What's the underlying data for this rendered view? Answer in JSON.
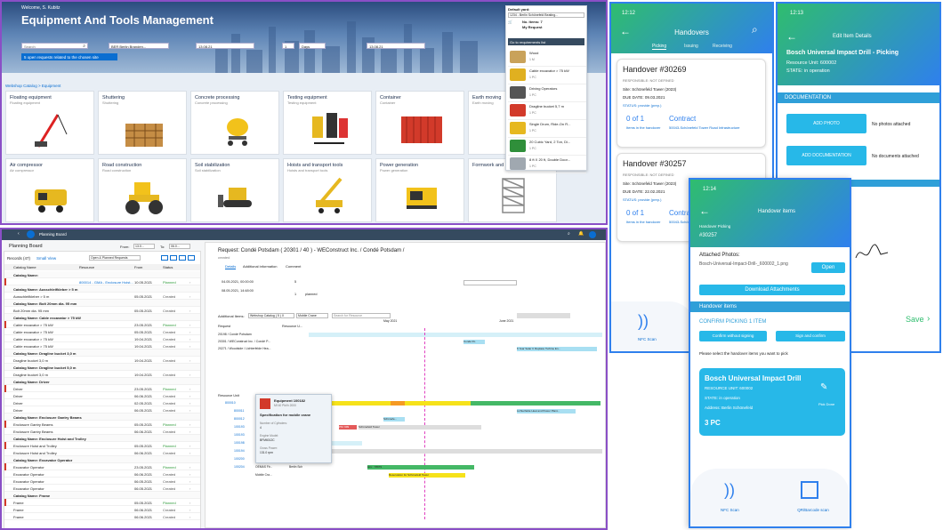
{
  "catalog": {
    "welcome": "Welcome, S. Kubitz",
    "title": "Equipment And Tools Management",
    "search_placeholder": "Search",
    "location": "BER Berlin Branden...",
    "date_from": "13.08.21",
    "days_value": "1",
    "days_unit": "Days",
    "date_to": "13.08.21",
    "requests_banner": "5 open requests related to the chosen site",
    "breadcrumb": "Webshop Catalog > Equipment",
    "default_yard_label": "Default yard:",
    "default_yard_value": "1234 - Berlin Schönefeld Beating...",
    "no_items": "No. Items: 7",
    "my_request": "My Request",
    "goto_list": "Go to requirements list",
    "tiles": [
      {
        "title": "Floating equipment",
        "sub": "Floating equipment"
      },
      {
        "title": "Shuttering",
        "sub": "Shuttering"
      },
      {
        "title": "Concrete processing",
        "sub": "Concrete processing"
      },
      {
        "title": "Testing equipment",
        "sub": "Testing equipment"
      },
      {
        "title": "Container",
        "sub": "Container"
      },
      {
        "title": "Earth moving",
        "sub": "Earth moving"
      },
      {
        "title": "Air compressor",
        "sub": "Air compressor"
      },
      {
        "title": "Road construction",
        "sub": "Road construction"
      },
      {
        "title": "Soil stabilization",
        "sub": "Soil stabilization"
      },
      {
        "title": "Hoists and transport tools",
        "sub": "Hoists and transport tools"
      },
      {
        "title": "Power generation",
        "sub": "Power generation"
      },
      {
        "title": "Formwork and",
        "sub": "Formwork and"
      }
    ],
    "request_items": [
      {
        "name": "Wood",
        "qty": "1 M",
        "color": "#c9a25a"
      },
      {
        "name": "Cable excavator > 75 kW",
        "qty": "1 PC",
        "color": "#e0b020"
      },
      {
        "name": "Driving Operators",
        "qty": "1 PC",
        "color": "#555555"
      },
      {
        "name": "Dragline bucket 5,7 m",
        "qty": "1 PC",
        "color": "#d23a2a"
      },
      {
        "name": "Single Drum, Ride-On R...",
        "qty": "1 PC",
        "color": "#e6b820"
      },
      {
        "name": "20 Cubic Yard, 2 Ton, Di...",
        "qty": "1 PC",
        "color": "#2f8f3a"
      },
      {
        "name": "8 ft X 20 ft, Double Door...",
        "qty": "1 PC",
        "color": "#a0a8b0"
      }
    ]
  },
  "planning": {
    "app_title": "Planning Board",
    "page_title": "Planning Board",
    "from_label": "From:",
    "from_value": "13.0...",
    "to_label": "To:",
    "to_value": "06.0...",
    "records": "Records (47)",
    "view": "Small View",
    "filter": "Open & Planned Requests",
    "columns": [
      "Catalog Name",
      "Resource",
      "From",
      "Status"
    ],
    "rows": [
      {
        "g": true,
        "name": "Catalog Name:"
      },
      {
        "name": "",
        "res": "800014 - GMA - Enclosure Hoist...",
        "from": "10.05.2021",
        "status": "Planned"
      },
      {
        "g": true,
        "name": "Catalog Name: Ausschleifkleber > 5 m"
      },
      {
        "name": "Ausschleifkleber > 5 m",
        "res": "",
        "from": "05.05.2021",
        "status": "Created"
      },
      {
        "g": true,
        "name": "Catalog Name: Bolt 20mm dia. 95 mm"
      },
      {
        "name": "Bolt 20mm dia. 95 mm",
        "res": "",
        "from": "05.05.2021",
        "status": "Created"
      },
      {
        "g": true,
        "name": "Catalog Name: Cable excavator > 75 kW"
      },
      {
        "name": "Cable excavator > 75 kW",
        "res": "",
        "from": "23.05.2021",
        "status": "Planned"
      },
      {
        "name": "Cable excavator > 75 kW",
        "res": "",
        "from": "05.05.2021",
        "status": "Created"
      },
      {
        "name": "Cable excavator > 75 kW",
        "res": "",
        "from": "19.04.2021",
        "status": "Created"
      },
      {
        "name": "Cable excavator > 75 kW",
        "res": "",
        "from": "19.04.2021",
        "status": "Created"
      },
      {
        "g": true,
        "name": "Catalog Name: Dragline bucket 3,0 m"
      },
      {
        "name": "Dragline bucket 3,0 m",
        "res": "",
        "from": "19.04.2021",
        "status": "Created"
      },
      {
        "g": true,
        "name": "Catalog Name: Dragline bucket 5,0 m"
      },
      {
        "name": "Dragline bucket 3,0 m",
        "res": "",
        "from": "19.04.2021",
        "status": "Created"
      },
      {
        "g": true,
        "name": "Catalog Name: Driver"
      },
      {
        "name": "Driver",
        "res": "",
        "from": "23.05.2021",
        "status": "Planned"
      },
      {
        "name": "Driver",
        "res": "",
        "from": "06.06.2021",
        "status": "Created"
      },
      {
        "name": "Driver",
        "res": "",
        "from": "02.05.2021",
        "status": "Created"
      },
      {
        "name": "Driver",
        "res": "",
        "from": "06.05.2021",
        "status": "Created"
      },
      {
        "g": true,
        "name": "Catalog Name: Enclosure Gantry Beams"
      },
      {
        "name": "Enclosure Gantry Beams",
        "res": "",
        "from": "05.05.2021",
        "status": "Planned"
      },
      {
        "name": "Enclosure Gantry Beams",
        "res": "",
        "from": "06.06.2021",
        "status": "Created"
      },
      {
        "g": true,
        "name": "Catalog Name: Enclosure Hoist and Trolley"
      },
      {
        "name": "Enclosure Hoist and Trolley",
        "res": "",
        "from": "05.05.2021",
        "status": "Planned"
      },
      {
        "name": "Enclosure Hoist and Trolley",
        "res": "",
        "from": "06.06.2021",
        "status": "Created"
      },
      {
        "g": true,
        "name": "Catalog Name: Excavator Operator"
      },
      {
        "name": "Excavator Operator",
        "res": "",
        "from": "23.05.2021",
        "status": "Planned"
      },
      {
        "name": "Excavator Operator",
        "res": "",
        "from": "06.06.2021",
        "status": "Created"
      },
      {
        "name": "Excavator Operator",
        "res": "",
        "from": "06.05.2021",
        "status": "Created"
      },
      {
        "name": "Excavator Operator",
        "res": "",
        "from": "06.05.2021",
        "status": "Created"
      },
      {
        "g": true,
        "name": "Catalog Name: Frame"
      },
      {
        "name": "Frame",
        "res": "",
        "from": "05.05.2021",
        "status": "Planned"
      },
      {
        "name": "Frame",
        "res": "",
        "from": "06.06.2021",
        "status": "Created"
      },
      {
        "name": "Frame",
        "res": "",
        "from": "06.06.2021",
        "status": "Created"
      }
    ],
    "request_title": "Request: Condé Potsdam ( 20301 / 40 ) - WEConstruct Inc. / Condé Potsdam /",
    "request_status": "created",
    "tabs": [
      "Details",
      "Additional information",
      "Comment"
    ],
    "from_dt": "04.05.2021, 00:00:00",
    "to_dt": "08.05.2021, 14:48:00",
    "in_use_for": "5",
    "requested_qty": "1",
    "planned": "planned",
    "additional_items": "Additional Items:",
    "filter_chips": [
      "Webshop Catalog ( 5 ) X",
      "Mobile Crane"
    ],
    "search_resource": "Search for Resource",
    "request_col": "Request",
    "resource_col": "Resource U...",
    "req_rows": [
      "20198 / Condé Potsdam",
      "20301 / WEConstruct Inc. / Condé P...",
      "20271 / Woodside / Lichterfelde Hea..."
    ],
    "bar_labels": [
      "Condé Po",
      "6 Year Solar C Replace Turbine En..."
    ],
    "months": [
      "May 2021",
      "June 2021"
    ],
    "resource_unit": "Resource Unit",
    "units": [
      "800010",
      "800011",
      "800012",
      "100193",
      "100193",
      "100198",
      "100194",
      "100200",
      "100204"
    ],
    "tooltip": {
      "title": "Equipment 100182",
      "sub": "Mf 40 Pkt/h 2000",
      "spec": "Specification for mobile crane",
      "cyl_label": "Number of Cylinders:",
      "cyl_value": "4",
      "engine_label": "Engine Model:",
      "engine_value": "BFM6012C",
      "power_label": "Gross Power:",
      "power_value": "131.0 rpm"
    },
    "gantt_labels": [
      "Lichterfelde Heat and Power Plant...",
      "Schönefe...",
      "PM: 999",
      "Schönefeld Tower",
      "OEMAS Fir...",
      "Berlin Sch",
      "Einr.: 78979",
      "Mobile Cra...",
      "Reservation for Schönefeld Tower"
    ]
  },
  "handovers": {
    "time": "12:12",
    "title": "Handovers",
    "tabs": [
      "Picking",
      "Issuing",
      "Receiving"
    ],
    "cards": [
      {
        "title": "Handover #30269",
        "responsible": "RESPONSIBLE: NOT DEFINED",
        "site": "Site: Schönefeld Tower (2023)",
        "due": "DUE DATE: 09.03.2021",
        "status": "STATUS: provide (prep.)",
        "count": "0 of 1",
        "count_sub": "Items in the handover",
        "contract": "Contract",
        "contract_sub": "50043-Schönefeld Tower Road Infrastructure"
      },
      {
        "title": "Handover #30257",
        "responsible": "RESPONSIBLE: NOT DEFINED",
        "site": "Site: Schönefeld Tower (2023)",
        "due": "DUE DATE: 22.02.2021",
        "status": "STATUS: provide (prep.)",
        "count": "0 of 1",
        "count_sub": "Items in the handover",
        "contract": "Contrac",
        "contract_sub": "50043-Schön"
      }
    ],
    "nfc": "NFC Scan"
  },
  "edit_item": {
    "time": "12:13",
    "title": "Edit Item Details",
    "item": "Bosch Universal Impact Drill - Picking",
    "resource_unit": "Resource Unit: 600002",
    "state": "STATE: in operation",
    "section": "DOCUMENTATION",
    "add_photo": "ADD PHOTO",
    "no_photos": "No photos attached",
    "add_doc": "ADD DOCUMENTATION",
    "no_docs": "No documents attached",
    "save": "Save"
  },
  "handover_items": {
    "time": "12:14",
    "title": "Handover items",
    "sub": "Handover Picking",
    "number": "#30257",
    "attached": "Attached Photos:",
    "file": "Bosch-Universal-Impact-Drill-_600002_1.png",
    "open": "Open",
    "download": "Download Attachments",
    "section": "Handover items",
    "confirm": "CONFIRM PICKING 1 ITEM",
    "confirm_wo": "Confirm without signing",
    "sign": "Sign and confirm",
    "hint": "Please select the handover items you want to pick",
    "card_title": "Bosch Universal Impact Drill",
    "card_ru": "RESOURCE UNIT: 600002",
    "card_state": "STATE: in operation",
    "card_addr": "Address: Berlin Schönefeld",
    "card_qty": "3 PC",
    "pick_done": "Pick Done",
    "nfc": "NFC Scan",
    "qr": "QR/Barcode scan"
  }
}
